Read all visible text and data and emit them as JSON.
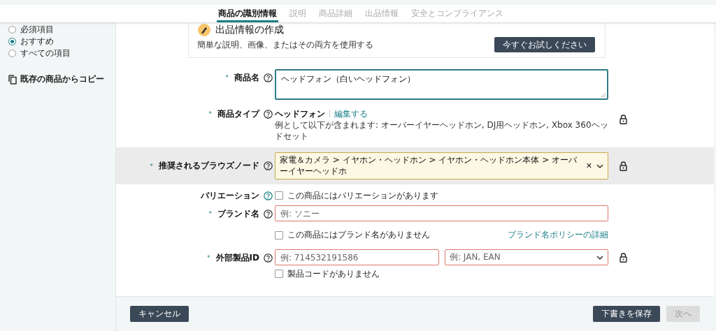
{
  "tabs": [
    {
      "label": "商品の識別情報",
      "selected": true
    },
    {
      "label": "説明",
      "selected": false
    },
    {
      "label": "商品詳細",
      "selected": false
    },
    {
      "label": "出品情報",
      "selected": false
    },
    {
      "label": "安全とコンプライアンス",
      "selected": false
    }
  ],
  "sidebar": {
    "filters": [
      {
        "label": "必須項目",
        "selected": false
      },
      {
        "label": "おすすめ",
        "selected": true
      },
      {
        "label": "すべての項目",
        "selected": false
      }
    ],
    "copy_link": "既存の商品からコピー"
  },
  "promo": {
    "title": "出品情報の作成",
    "description": "簡単な説明、画像、またはその両方を使用する",
    "button": "今すぐお試しください"
  },
  "fields": [
    {
      "kind": "textarea",
      "label": "商品名",
      "required_mark": "*",
      "value": "ヘッドフォン（白いヘッドフォン）",
      "focused": true
    },
    {
      "kind": "type",
      "label": "商品タイプ",
      "required_mark": "*",
      "value": "ヘッドフォン",
      "edit": "編集する",
      "hint": "例として以下が含まれます: オーバーイヤーヘッドホン, DJ用ヘッドホン, Xbox 360ヘッドセット",
      "locked": true
    },
    {
      "kind": "node",
      "label": "推奨されるブラウズノード",
      "required_mark": "*",
      "value": "家電＆カメラ > イヤホン・ヘッドホン > イヤホン・ヘッドホン本体 > オーバーイヤーヘッドホ",
      "clear": "✕",
      "locked": true,
      "highlighted": true
    },
    {
      "kind": "checkbox",
      "label": "バリエーション",
      "option": "この商品にはバリエーションがあります",
      "checked": false
    },
    {
      "kind": "brand",
      "label": "ブランド名",
      "required_mark": "*",
      "placeholder": "例: ソニー",
      "error": true,
      "option": "この商品にはブランド名がありません",
      "checked": false,
      "link": "ブランド名ポリシーの詳細"
    },
    {
      "kind": "id",
      "label": "外部製品ID",
      "required_mark": "*",
      "placeholder": "例: 714532191586",
      "select_placeholder": "例: JAN, EAN",
      "error": true,
      "option": "製品コードがありません",
      "checked": false,
      "locked": true
    }
  ],
  "footer": {
    "cancel": "キャンセル",
    "save": "下書きを保存",
    "next": "次へ",
    "next_disabled": true
  }
}
